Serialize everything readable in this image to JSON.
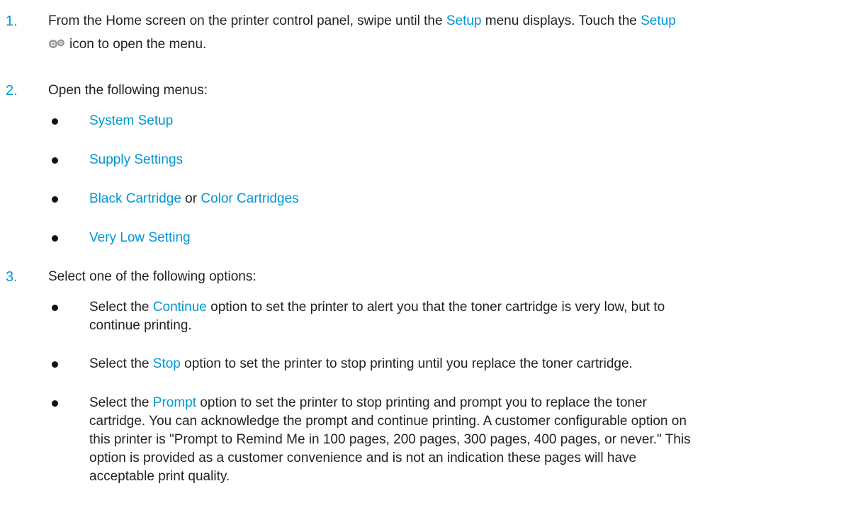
{
  "steps": [
    {
      "number": "1.",
      "text_before_setup1": "From the Home screen on the printer control panel, swipe until the ",
      "setup1": "Setup",
      "text_between": " menu displays. Touch the ",
      "setup2": "Setup",
      "text_after": "icon to open the menu.",
      "icon": "gear-icon"
    },
    {
      "number": "2.",
      "text": "Open the following menus:",
      "menus": [
        {
          "label": "System Setup"
        },
        {
          "label": "Supply Settings"
        },
        {
          "label": "Black Cartridge",
          "joiner": " or ",
          "label2": "Color Cartridges"
        },
        {
          "label": "Very Low Setting"
        }
      ]
    },
    {
      "number": "3.",
      "text": "Select one of the following options:",
      "options": [
        {
          "prefix": "Select the ",
          "keyword": "Continue",
          "suffix_line1": " option to set the printer to alert you that the toner cartridge is very low, but to",
          "line2": "continue printing."
        },
        {
          "prefix": "Select the ",
          "keyword": "Stop",
          "suffix_line1": " option to set the printer to stop printing until you replace the toner cartridge."
        },
        {
          "prefix": "Select the ",
          "keyword": "Prompt",
          "suffix_line1": " option to set the printer to stop printing and prompt you to replace the toner",
          "line2": "cartridge. You can acknowledge the prompt and continue printing. A customer configurable option on",
          "line3": "this printer is \"Prompt to Remind Me in 100 pages, 200 pages, 300 pages, 400 pages, or never.\" This",
          "line4": "option is provided as a customer convenience and is not an indication these pages will have",
          "line5": "acceptable print quality."
        }
      ]
    }
  ],
  "colors": {
    "accent": "#0096d6",
    "text": "#222222",
    "bullet": "#111111"
  }
}
